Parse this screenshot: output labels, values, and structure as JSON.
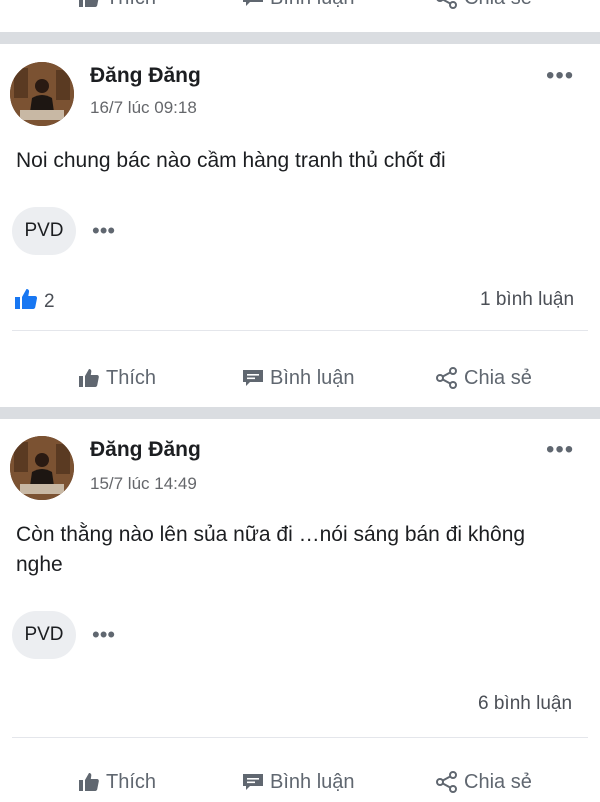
{
  "actions": {
    "like_label": "Thích",
    "comment_label": "Bình luận",
    "share_label": "Chia sẻ"
  },
  "posts": [
    {
      "author": "Đăng Đăng",
      "time": "16/7 lúc 09:18",
      "text": "Noi chung bác nào cầm hàng tranh thủ chốt đi",
      "tag": "PVD",
      "tag_more": "•••",
      "more": "•••",
      "likes": "2",
      "comments": "1 bình luận"
    },
    {
      "author": "Đăng Đăng",
      "time": "15/7 lúc 14:49",
      "text": "Còn thằng nào lên sủa nữa đi …nói sáng bán đi không nghe",
      "tag": "PVD",
      "tag_more": "•••",
      "more": "•••",
      "comments": "6 bình luận"
    }
  ],
  "colors": {
    "like_blue": "#1877f2",
    "separator": "#dadde1",
    "muted_text": "#65676b"
  },
  "icons": [
    "thumbs-up-icon",
    "comment-icon",
    "share-icon",
    "more-icon",
    "like-reaction-icon"
  ]
}
